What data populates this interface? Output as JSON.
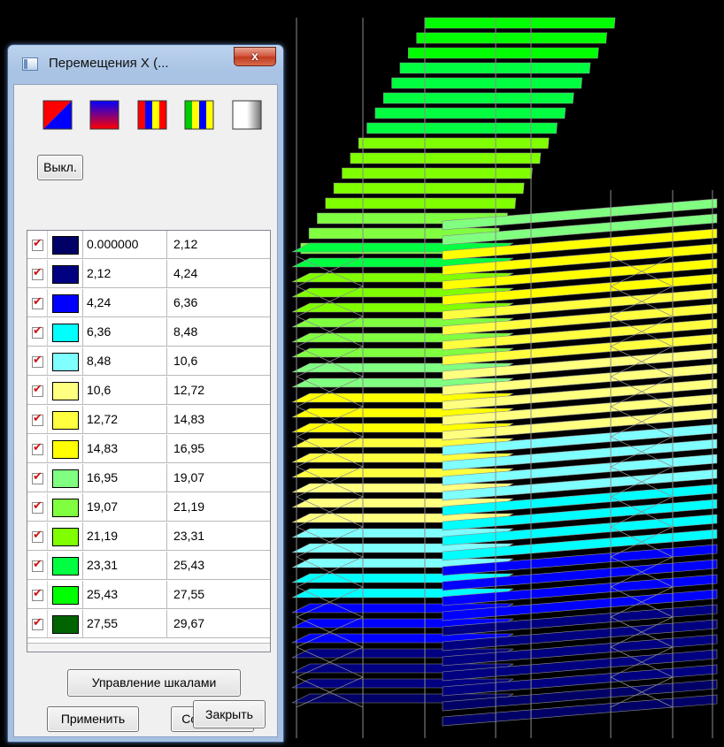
{
  "window": {
    "title": "Перемещения X (...",
    "close_label": "x"
  },
  "toolbar": {
    "palettes": [
      "palette-diagonal-icon",
      "palette-gradient-icon",
      "palette-stripes-warm-icon",
      "palette-stripes-cool-icon",
      "palette-grayscale-icon"
    ],
    "off_label": "Выкл."
  },
  "legend": [
    {
      "from": "0.000000",
      "to": "2,12",
      "color": "#000066",
      "checked": true
    },
    {
      "from": "2,12",
      "to": "4,24",
      "color": "#000080",
      "checked": true
    },
    {
      "from": "4,24",
      "to": "6,36",
      "color": "#0000ff",
      "checked": true
    },
    {
      "from": "6,36",
      "to": "8,48",
      "color": "#00ffff",
      "checked": true
    },
    {
      "from": "8,48",
      "to": "10,6",
      "color": "#80ffff",
      "checked": true
    },
    {
      "from": "10,6",
      "to": "12,72",
      "color": "#ffff80",
      "checked": true
    },
    {
      "from": "12,72",
      "to": "14,83",
      "color": "#ffff40",
      "checked": true
    },
    {
      "from": "14,83",
      "to": "16,95",
      "color": "#ffff00",
      "checked": true
    },
    {
      "from": "16,95",
      "to": "19,07",
      "color": "#80ff80",
      "checked": true
    },
    {
      "from": "19,07",
      "to": "21,19",
      "color": "#80ff40",
      "checked": true
    },
    {
      "from": "21,19",
      "to": "23,31",
      "color": "#80ff00",
      "checked": true
    },
    {
      "from": "23,31",
      "to": "25,43",
      "color": "#00ff40",
      "checked": true
    },
    {
      "from": "25,43",
      "to": "27,55",
      "color": "#00ff00",
      "checked": true
    },
    {
      "from": "27,55",
      "to": "29,67",
      "color": "#006400",
      "checked": true
    }
  ],
  "buttons": {
    "scales": "Управление шкалами",
    "apply": "Применить",
    "save": "Сохранить",
    "close": "Закрыть"
  },
  "model": {
    "frame_color": "#8c8c8c",
    "background": "#000000"
  }
}
